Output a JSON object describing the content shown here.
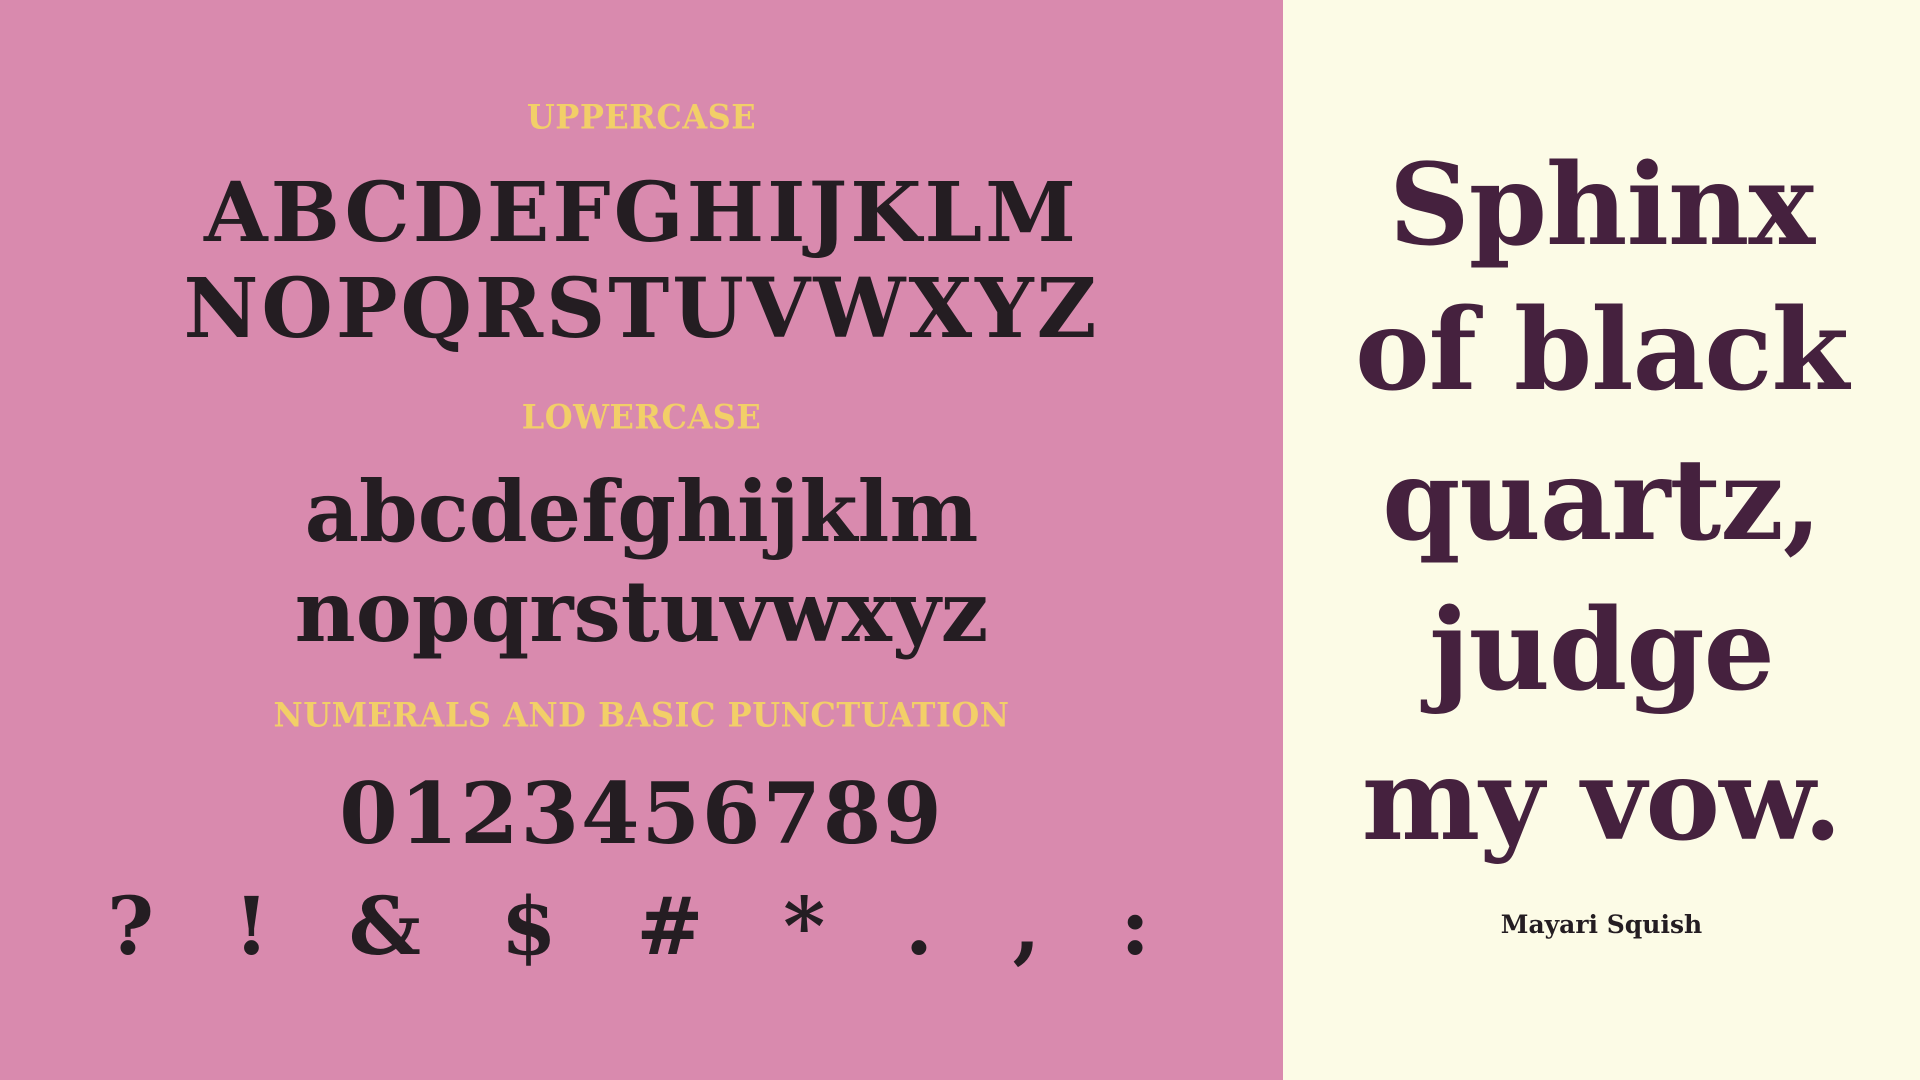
{
  "colors": {
    "left_background": "#d98aae",
    "right_background": "#fcfbe6",
    "label_color": "#f2cf68",
    "glyph_color": "#241d22",
    "pangram_color": "#45213e"
  },
  "specimen": {
    "uppercase_label": "UPPERCASE",
    "uppercase_line_1": "ABCDEFGHIJKLM",
    "uppercase_line_2": "NOPQRSTUVWXYZ",
    "lowercase_label": "LOWERCASE",
    "lowercase_line_1": "abcdefghijklm",
    "lowercase_line_2": "nopqrstuvwxyz",
    "numerals_label": "NUMERALS AND BASIC PUNCTUATION",
    "numerals_line": "0123456789",
    "punctuation_line": "? ! & $ # * . , :"
  },
  "pangram": {
    "lines": [
      "Sphinx",
      "of black",
      "quartz,",
      "judge",
      "my vow."
    ]
  },
  "font_name": "Mayari Squish"
}
